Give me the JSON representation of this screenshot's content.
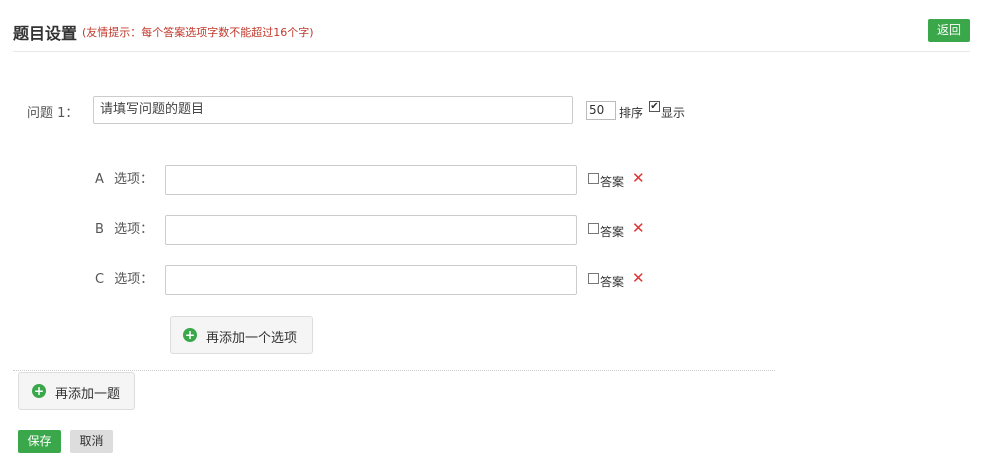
{
  "header": {
    "title": "题目设置",
    "hint": "(友情提示：每个答案选项字数不能超过16个字)",
    "back_label": "返回"
  },
  "question": {
    "label": "问题 1：",
    "placeholder": "请填写问题的题目",
    "sort_value": "50",
    "sort_label": "排序",
    "show_label": "显示",
    "show_checked": true
  },
  "options": [
    {
      "letter": "A",
      "label": "选项：",
      "value": "",
      "answer_label": "答案",
      "delete_icon": "close-icon"
    },
    {
      "letter": "B",
      "label": "选项：",
      "value": "",
      "answer_label": "答案",
      "delete_icon": "close-icon"
    },
    {
      "letter": "C",
      "label": "选项：",
      "value": "",
      "answer_label": "答案",
      "delete_icon": "close-icon"
    }
  ],
  "add_option_label": "再添加一个选项",
  "add_question_label": "再添加一题",
  "footer": {
    "save_label": "保存",
    "cancel_label": "取消"
  },
  "colors": {
    "primary": "#3aa84a",
    "hint": "#c0392b",
    "delete": "#dd3333"
  }
}
